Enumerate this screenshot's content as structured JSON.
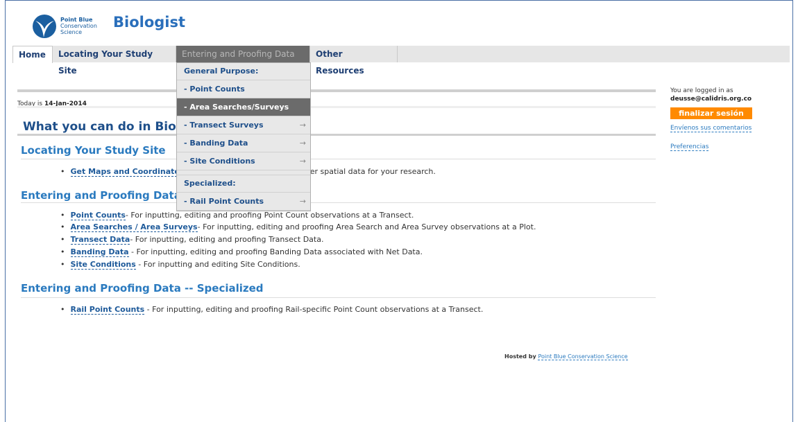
{
  "brand": {
    "org_line1": "Point Blue",
    "org_line2": "Conservation",
    "org_line3": "Science",
    "app_title": "Biologist"
  },
  "nav": {
    "tabs": [
      {
        "label": "Home"
      },
      {
        "label": "Locating Your Study Site"
      },
      {
        "label": "Entering and Proofing Data"
      },
      {
        "label": "Other Resources"
      }
    ]
  },
  "dropdown": {
    "general_header": "General Purpose:",
    "items": [
      {
        "label": "- Point Counts"
      },
      {
        "label": "- Area Searches/Surveys"
      },
      {
        "label": "- Transect Surveys"
      },
      {
        "label": "- Banding Data"
      },
      {
        "label": "- Site Conditions"
      }
    ],
    "specialized_header": "Specialized:",
    "specialized_items": [
      {
        "label": "- Rail Point Counts"
      }
    ],
    "arrow": "→"
  },
  "main": {
    "today_prefix": "Today is",
    "today_date": "14-Jan-2014",
    "heading": "What you can do in Biologist",
    "sections": [
      {
        "title": "Locating Your Study Site",
        "bullets": [
          {
            "link": "Get Maps and Coordinates",
            "text": " - Get maps, coordinates and other spatial data for your research."
          }
        ]
      },
      {
        "title": "Entering and Proofing Data",
        "bullets": [
          {
            "link": "Point Counts",
            "text": "- For inputting, editing and proofing Point Count observations at a Transect."
          },
          {
            "link": "Area Searches / Area Surveys",
            "text": "- For inputting, editing and proofing Area Search and Area Survey observations at a Plot."
          },
          {
            "link": "Transect Data",
            "text": "- For inputting, editing and proofing Transect Data."
          },
          {
            "link": "Banding Data",
            "text": " - For inputting, editing and proofing Banding Data associated with Net Data."
          },
          {
            "link": "Site Conditions",
            "text": " - For inputting and editing Site Conditions."
          }
        ]
      },
      {
        "title": "Entering and Proofing Data -- Specialized",
        "bullets": [
          {
            "link": "Rail Point Counts",
            "text": " - For inputting, editing and proofing Rail-specific Point Count observations at a Transect."
          }
        ]
      }
    ],
    "hosted_prefix": "Hosted by",
    "hosted_link": "Point Blue Conservation Science"
  },
  "sidebar": {
    "logged_in_label": "You are logged in as",
    "user_email": "deusse@calidris.org.co",
    "logout_label": "finalizar sesión",
    "feedback_link": "Envíenos sus comentarios",
    "preferences_link": "Preferencias"
  },
  "colors": {
    "accent": "#2a7abf",
    "logout": "#ff8a00",
    "active_tab": "#6b6b6b"
  }
}
